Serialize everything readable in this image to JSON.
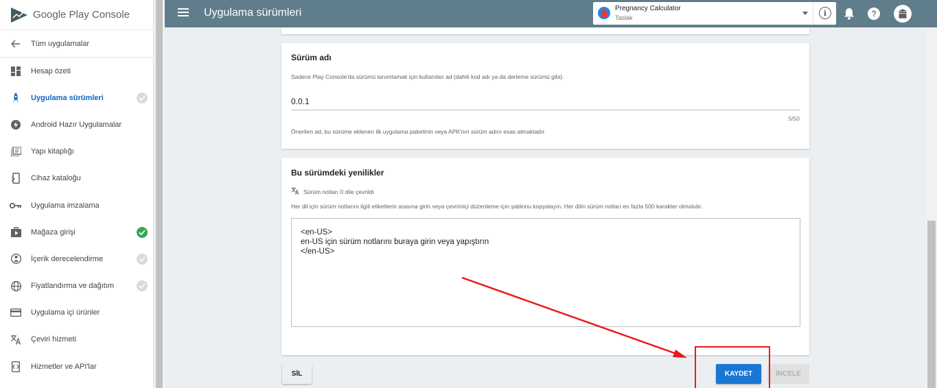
{
  "brand": {
    "name": "Google Play Console"
  },
  "sidebar": {
    "back_label": "Tüm uygulamalar",
    "items": [
      {
        "label": "Hesap özeti",
        "icon": "dashboard-icon"
      },
      {
        "label": "Uygulama sürümleri",
        "icon": "rocket-icon",
        "active": true,
        "status": "grey-check"
      },
      {
        "label": "Android Hazır Uygulamalar",
        "icon": "bolt-icon"
      },
      {
        "label": "Yapı kitaplığı",
        "icon": "library-icon"
      },
      {
        "label": "Cihaz kataloğu",
        "icon": "device-icon"
      },
      {
        "label": "Uygulama imzalama",
        "icon": "key-icon"
      },
      {
        "label": "Mağaza girişi",
        "icon": "store-icon",
        "status": "green-check"
      },
      {
        "label": "İçerik derecelendirme",
        "icon": "rating-icon",
        "status": "grey-check"
      },
      {
        "label": "Fiyatlandırma ve dağıtım",
        "icon": "globe-icon",
        "status": "grey-check"
      },
      {
        "label": "Uygulama içi ürünler",
        "icon": "card-icon"
      },
      {
        "label": "Çeviri hizmeti",
        "icon": "translate-icon"
      },
      {
        "label": "Hizmetler ve API'lar",
        "icon": "api-icon"
      }
    ]
  },
  "header": {
    "title": "Uygulama sürümleri",
    "app_name": "Pregnancy Calculator",
    "app_status": "Taslak",
    "info_glyph": "i",
    "help_glyph": "?"
  },
  "release_name": {
    "title": "Sürüm adı",
    "description": "Sadece Play Console'da sürümü tanımlamak için kullanılan ad (dahili kod adı ya da derleme sürümü gibi).",
    "value": "0.0.1",
    "counter": "5/50",
    "hint": "Önerilen ad, bu sürüme eklenen ilk uygulama paketinin veya APK'nın sürüm adını esas almaktadır."
  },
  "release_notes": {
    "title": "Bu sürümdeki yenilikler",
    "translated_label": "Sürüm notları 0 dile çevrildi",
    "description": "Her dil için sürüm notlarını ilgili etiketlerin arasına girin veya çevrimiçi düzenleme için şablonu kopyalayın. Her dilin sürüm notları en fazla 500 karakter olmalıdır.",
    "line1": "<en-US>",
    "line2": "en-US için sürüm notlarını buraya girin veya yapıştırın",
    "line3": "</en-US>"
  },
  "actions": {
    "delete_label": "SİL",
    "save_label": "KAYDET",
    "review_label": "İNCELE"
  },
  "colors": {
    "header": "#607d8b",
    "primary": "#1976d2",
    "annotation": "#e8191b",
    "check_green": "#34a853"
  }
}
